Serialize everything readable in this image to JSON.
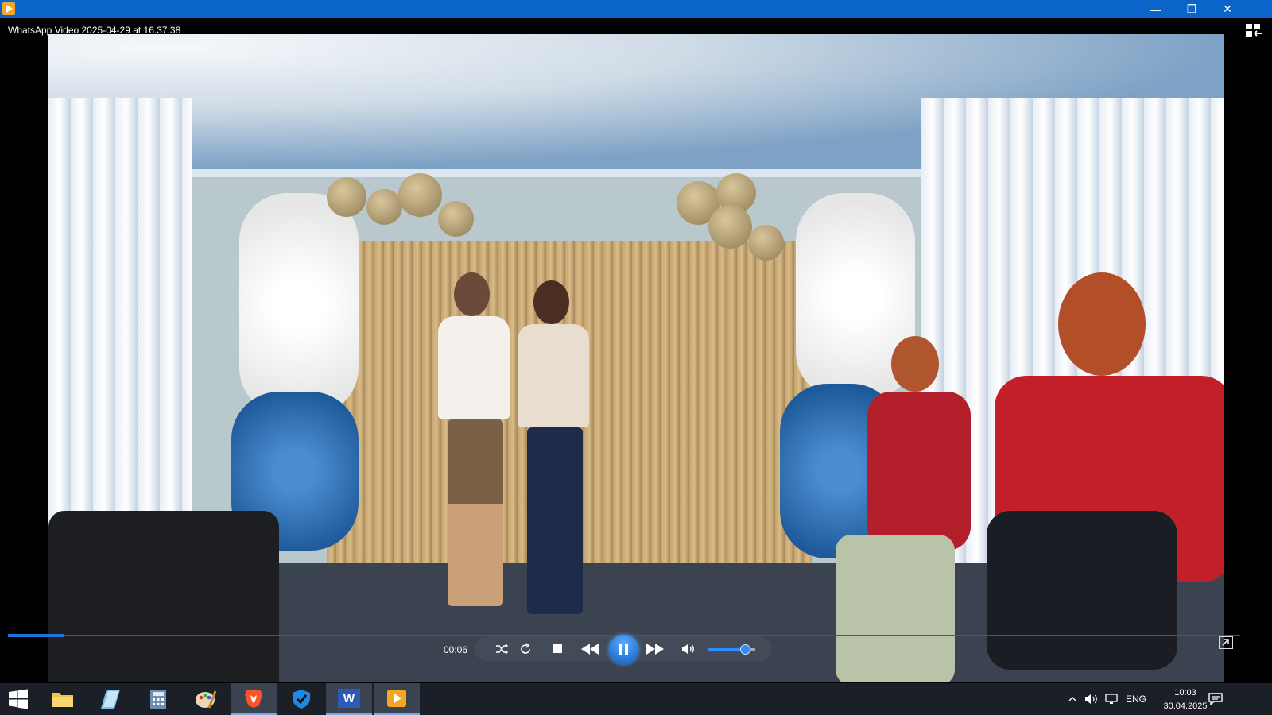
{
  "window": {
    "title": "WhatsApp Video 2025-04-29 at 16.37.38",
    "minimize_glyph": "—",
    "restore_glyph": "❐",
    "close_glyph": "✕"
  },
  "player": {
    "elapsed_time": "00:06",
    "progress_fraction": 0.045,
    "volume_fraction": 0.78,
    "state": "playing"
  },
  "taskbar": {
    "language": "ENG",
    "clock_time": "10:03",
    "clock_date": "30.04.2025",
    "pinned": [
      {
        "name": "start-icon"
      },
      {
        "name": "file-explorer-icon"
      },
      {
        "name": "notes-icon"
      },
      {
        "name": "calculator-icon"
      },
      {
        "name": "paint-icon"
      },
      {
        "name": "brave-browser-icon"
      },
      {
        "name": "defender-icon"
      },
      {
        "name": "word-icon",
        "label": "W"
      },
      {
        "name": "media-player-icon"
      }
    ]
  },
  "colors": {
    "titlebar": "#0a64c9",
    "accent": "#1e74d9",
    "taskbar": "#1b1f27"
  }
}
